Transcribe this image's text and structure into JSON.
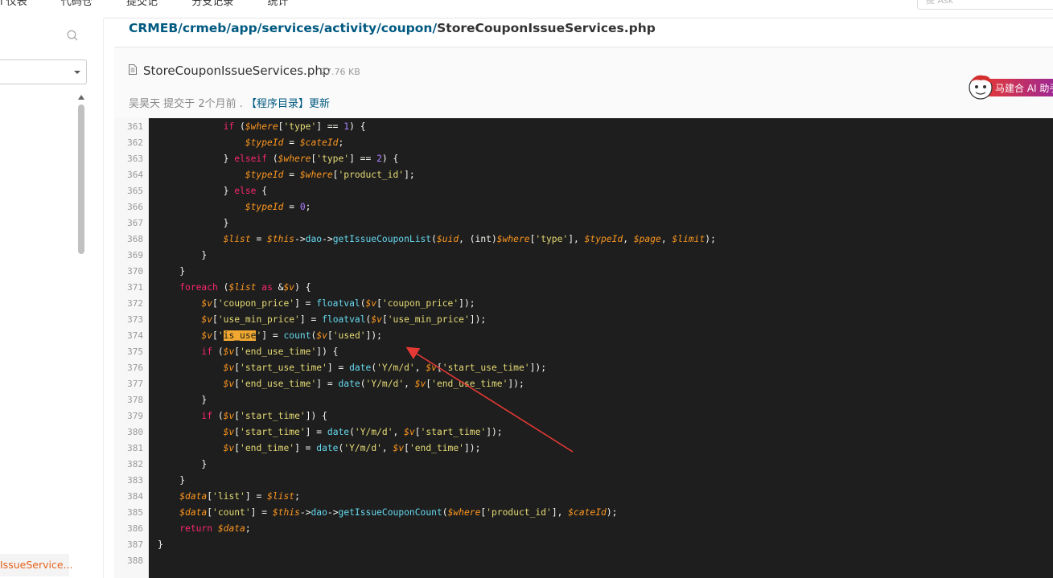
{
  "topbar": {
    "nav": [
      "i 仪表",
      "代码仓",
      "提交记",
      "分支记录",
      "统计"
    ],
    "search_placeholder": "提 Ask"
  },
  "sidebar": {
    "active_file": "IssueService..."
  },
  "header": {
    "path": [
      "CRMEB",
      "crmeb",
      "app",
      "services",
      "activity",
      "coupon"
    ],
    "path_file": "StoreCouponIssueServices.php",
    "file_name": "StoreCouponIssueServices.php",
    "file_size": "27.76 KB",
    "author": "吴昊天",
    "commit_prefix": "提交于",
    "commit_time": "2个月前",
    "commit_msg": "【程序目录】更新",
    "ai_button": "马建合 AI 助手"
  },
  "code": {
    "lines": [
      {
        "n": "361",
        "html": "            <span class='kw'>if</span> (<span class='var'>$where</span>[<span class='str'>'type'</span>] == <span class='num'>1</span>) {"
      },
      {
        "n": "362",
        "html": "                <span class='var'>$typeId</span> = <span class='var'>$cateId</span>;"
      },
      {
        "n": "363",
        "html": "            } <span class='kw'>elseif</span> (<span class='var'>$where</span>[<span class='str'>'type'</span>] == <span class='num'>2</span>) {"
      },
      {
        "n": "364",
        "html": "                <span class='var'>$typeId</span> = <span class='var'>$where</span>[<span class='str'>'product_id'</span>];"
      },
      {
        "n": "365",
        "html": "            } <span class='kw'>else</span> {"
      },
      {
        "n": "366",
        "html": "                <span class='var'>$typeId</span> = <span class='num'>0</span>;"
      },
      {
        "n": "367",
        "html": "            }"
      },
      {
        "n": "368",
        "html": "            <span class='var'>$list</span> = <span class='var'>$this</span>-><span class='fn'>dao</span>-><span class='fn'>getIssueCouponList</span>(<span class='var'>$uid</span>, (int)<span class='var'>$where</span>[<span class='str'>'type'</span>], <span class='var'>$typeId</span>, <span class='var'>$page</span>, <span class='var'>$limit</span>);"
      },
      {
        "n": "369",
        "html": "        }"
      },
      {
        "n": "370",
        "html": "    }"
      },
      {
        "n": "371",
        "html": "    <span class='kw'>foreach</span> (<span class='var'>$list</span> <span class='kw'>as</span> &amp;<span class='var'>$v</span>) {"
      },
      {
        "n": "372",
        "html": "        <span class='var'>$v</span>[<span class='str'>'coupon_price'</span>] = <span class='fn'>floatval</span>(<span class='var'>$v</span>[<span class='str'>'coupon_price'</span>]);"
      },
      {
        "n": "373",
        "html": "        <span class='var'>$v</span>[<span class='str'>'use_min_price'</span>] = <span class='fn'>floatval</span>(<span class='var'>$v</span>[<span class='str'>'use_min_price'</span>]);"
      },
      {
        "n": "374",
        "html": "        <span class='var'>$v</span>[<span class='str'>'<span class='hl'>is_use</span>'</span>] = <span class='fn'>count</span>(<span class='var'>$v</span>[<span class='str'>'used'</span>]);"
      },
      {
        "n": "375",
        "html": "        <span class='kw'>if</span> (<span class='var'>$v</span>[<span class='str'>'end_use_time'</span>]) {"
      },
      {
        "n": "376",
        "html": "            <span class='var'>$v</span>[<span class='str'>'start_use_time'</span>] = <span class='fn'>date</span>(<span class='str'>'Y/m/d'</span>, <span class='var'>$v</span>[<span class='str'>'start_use_time'</span>]);"
      },
      {
        "n": "377",
        "html": "            <span class='var'>$v</span>[<span class='str'>'end_use_time'</span>] = <span class='fn'>date</span>(<span class='str'>'Y/m/d'</span>, <span class='var'>$v</span>[<span class='str'>'end_use_time'</span>]);"
      },
      {
        "n": "378",
        "html": "        }"
      },
      {
        "n": "379",
        "html": "        <span class='kw'>if</span> (<span class='var'>$v</span>[<span class='str'>'start_time'</span>]) {"
      },
      {
        "n": "380",
        "html": "            <span class='var'>$v</span>[<span class='str'>'start_time'</span>] = <span class='fn'>date</span>(<span class='str'>'Y/m/d'</span>, <span class='var'>$v</span>[<span class='str'>'start_time'</span>]);"
      },
      {
        "n": "381",
        "html": "            <span class='var'>$v</span>[<span class='str'>'end_time'</span>] = <span class='fn'>date</span>(<span class='str'>'Y/m/d'</span>, <span class='var'>$v</span>[<span class='str'>'end_time'</span>]);"
      },
      {
        "n": "382",
        "html": "        }"
      },
      {
        "n": "383",
        "html": "    }"
      },
      {
        "n": "384",
        "html": "    <span class='var'>$data</span>[<span class='str'>'list'</span>] = <span class='var'>$list</span>;"
      },
      {
        "n": "385",
        "html": "    <span class='var'>$data</span>[<span class='str'>'count'</span>] = <span class='var'>$this</span>-><span class='fn'>dao</span>-><span class='fn'>getIssueCouponCount</span>(<span class='var'>$where</span>[<span class='str'>'product_id'</span>], <span class='var'>$cateId</span>);"
      },
      {
        "n": "386",
        "html": "    <span class='kw'>return</span> <span class='var'>$data</span>;"
      },
      {
        "n": "387",
        "html": "}"
      },
      {
        "n": "388",
        "html": ""
      }
    ]
  },
  "colors": {
    "link": "#005980",
    "code_bg": "#1e1e1e",
    "keyword": "#f92672",
    "variable": "#fd971f",
    "string": "#e6db74",
    "highlight": "#f0a830",
    "annotation_arrow": "#e53935"
  }
}
